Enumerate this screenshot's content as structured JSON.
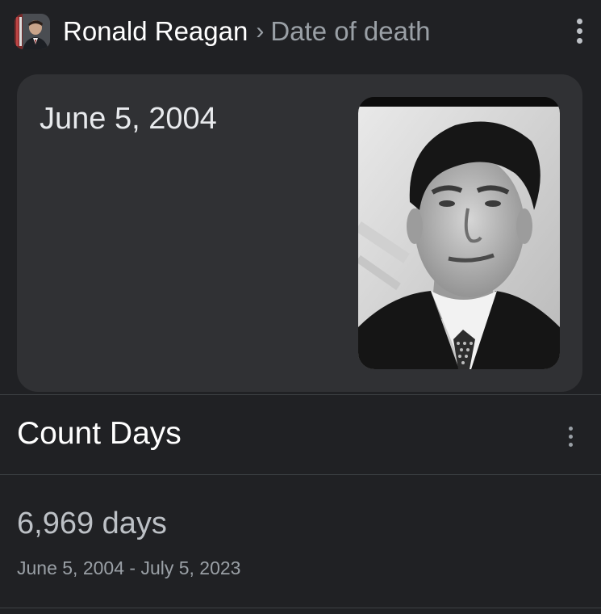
{
  "header": {
    "avatar_icon": "ronald-reagan-avatar",
    "entity": "Ronald Reagan",
    "separator": "›",
    "attribute": "Date of death",
    "menu_icon": "more-vert-icon"
  },
  "answer": {
    "value": "June 5, 2004",
    "photo_icon": "ronald-reagan-portrait"
  },
  "count_days": {
    "title": "Count Days",
    "menu_icon": "more-vert-icon",
    "value": "6,969 days",
    "range": "June 5, 2004 - July 5, 2023"
  },
  "colors": {
    "background": "#202124",
    "card": "#303134",
    "primary_text": "#e8eaed",
    "secondary_text": "#9aa0a6"
  }
}
